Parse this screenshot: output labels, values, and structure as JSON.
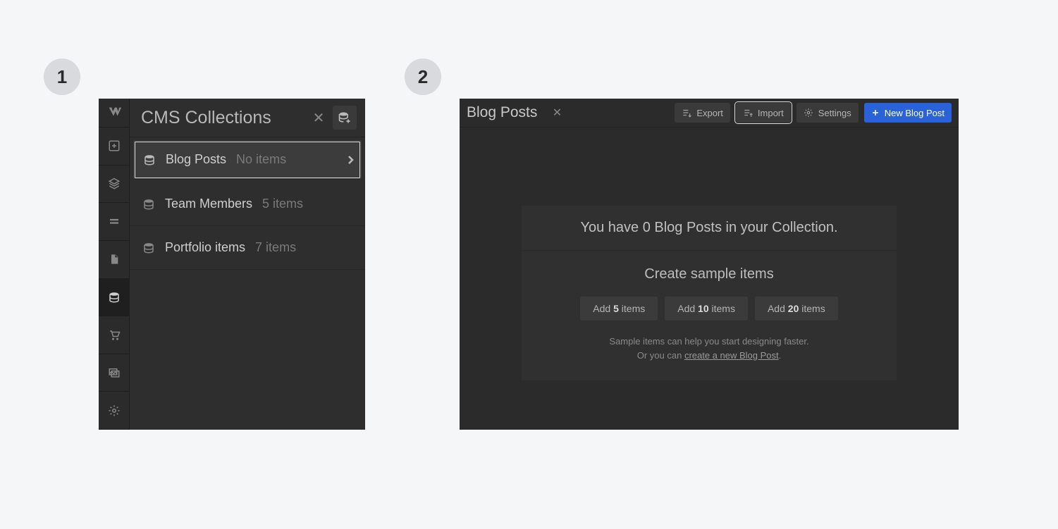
{
  "steps": {
    "one": "1",
    "two": "2"
  },
  "panel1": {
    "title": "CMS Collections",
    "collections": [
      {
        "name": "Blog Posts",
        "count": "No items",
        "selected": true
      },
      {
        "name": "Team Members",
        "count": "5 items",
        "selected": false
      },
      {
        "name": "Portfolio items",
        "count": "7 items",
        "selected": false
      }
    ]
  },
  "panel2": {
    "title": "Blog Posts",
    "toolbar": {
      "export": "Export",
      "import": "Import",
      "settings": "Settings",
      "new_item": "New Blog Post"
    },
    "empty": {
      "headline": "You have 0 Blog Posts in your Collection.",
      "subtitle": "Create sample items",
      "add5_pre": "Add ",
      "add5_n": "5",
      "add5_post": " items",
      "add10_pre": "Add ",
      "add10_n": "10",
      "add10_post": " items",
      "add20_pre": "Add ",
      "add20_n": "20",
      "add20_post": " items",
      "hint1": "Sample items can help you start designing faster.",
      "hint2_pre": "Or you can ",
      "hint2_link": "create a new Blog Post",
      "hint2_post": "."
    }
  }
}
